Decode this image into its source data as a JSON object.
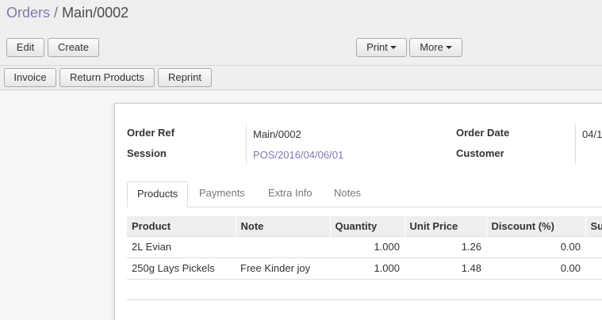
{
  "breadcrumb": {
    "parent": "Orders",
    "separator": "/",
    "current": "Main/0002"
  },
  "toolbar": {
    "edit": "Edit",
    "create": "Create",
    "print": "Print",
    "more": "More"
  },
  "statusbar": {
    "invoice": "Invoice",
    "return_products": "Return Products",
    "reprint": "Reprint"
  },
  "form": {
    "order_ref_label": "Order Ref",
    "order_ref": "Main/0002",
    "session_label": "Session",
    "session": "POS/2016/04/06/01",
    "order_date_label": "Order Date",
    "order_date": "04/1",
    "customer_label": "Customer",
    "customer": ""
  },
  "tabs": [
    "Products",
    "Payments",
    "Extra Info",
    "Notes"
  ],
  "table": {
    "headers": [
      "Product",
      "Note",
      "Quantity",
      "Unit Price",
      "Discount (%)",
      "Su"
    ],
    "rows": [
      [
        "2L Evian",
        "",
        "1.000",
        "1.26",
        "0.00",
        ""
      ],
      [
        "250g Lays Pickels",
        "Free Kinder joy",
        "1.000",
        "1.48",
        "0.00",
        ""
      ]
    ]
  }
}
